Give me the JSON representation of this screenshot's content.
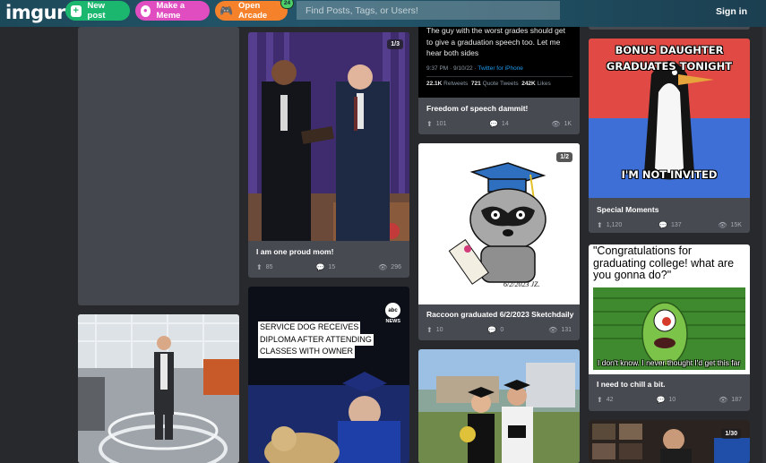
{
  "header": {
    "logo": "imgur",
    "new_post": "New post",
    "make_meme": "Make a Meme",
    "open_arcade": "Open Arcade",
    "arcade_badge": "24",
    "search_placeholder": "Find Posts, Tags, or Users!",
    "sign_in": "Sign in"
  },
  "posts": {
    "proud_mom": {
      "title": "I am one proud mom!",
      "upvotes": "85",
      "comments": "15",
      "views": "296",
      "count": "1/3"
    },
    "service_dog": {
      "caption_line1": "SERVICE DOG RECEIVES",
      "caption_line2": "DIPLOMA AFTER ATTENDING",
      "caption_line3": "CLASSES WITH OWNER",
      "network_logo": "abc",
      "network_sub": "NEWS"
    },
    "freedom": {
      "tweet_text": "The guy with the worst grades should get to give a graduation speech too. Let me hear both sides",
      "tweet_time": "9:37 PM · 9/10/22 · ",
      "tweet_client": "Twitter for iPhone",
      "retweets": "22.1K",
      "retweets_label": "Retweets",
      "quotes": "721",
      "quotes_label": "Quote Tweets",
      "likes": "242K",
      "likes_label": "Likes",
      "title": "Freedom of speech dammit!",
      "upvotes": "101",
      "comments": "14",
      "views": "1K"
    },
    "raccoon": {
      "title": "Raccoon graduated 6/2/2023 Sketchdaily",
      "upvotes": "10",
      "comments": "0",
      "views": "131",
      "count": "1/2",
      "drawing_date": "6/2/2023 JZ."
    },
    "special": {
      "meme_top": "BONUS DAUGHTER GRADUATES TONIGHT",
      "meme_bottom": "I'M NOT INVITED",
      "title": "Special Moments",
      "upvotes": "1,120",
      "comments": "137",
      "views": "15K"
    },
    "chill": {
      "meme_text": "\"Congratulations for graduating college! what are you gonna do?\"",
      "meme_caption": "I don't know. I never thought I'd get this far",
      "title": "I need to chill a bit.",
      "upvotes": "42",
      "comments": "10",
      "views": "187"
    },
    "bottom_right": {
      "count": "1/30"
    }
  },
  "colors": {
    "header_bg": "#23556b",
    "page_bg": "#27292d",
    "card_bg": "#474a51",
    "new_post": "#1bb76e",
    "make_meme": "#e04dc0",
    "open_arcade": "#f5812a"
  },
  "icons": {
    "upvote": "up-arrow-icon",
    "comment": "speech-bubble-icon",
    "views": "eye-icon"
  }
}
